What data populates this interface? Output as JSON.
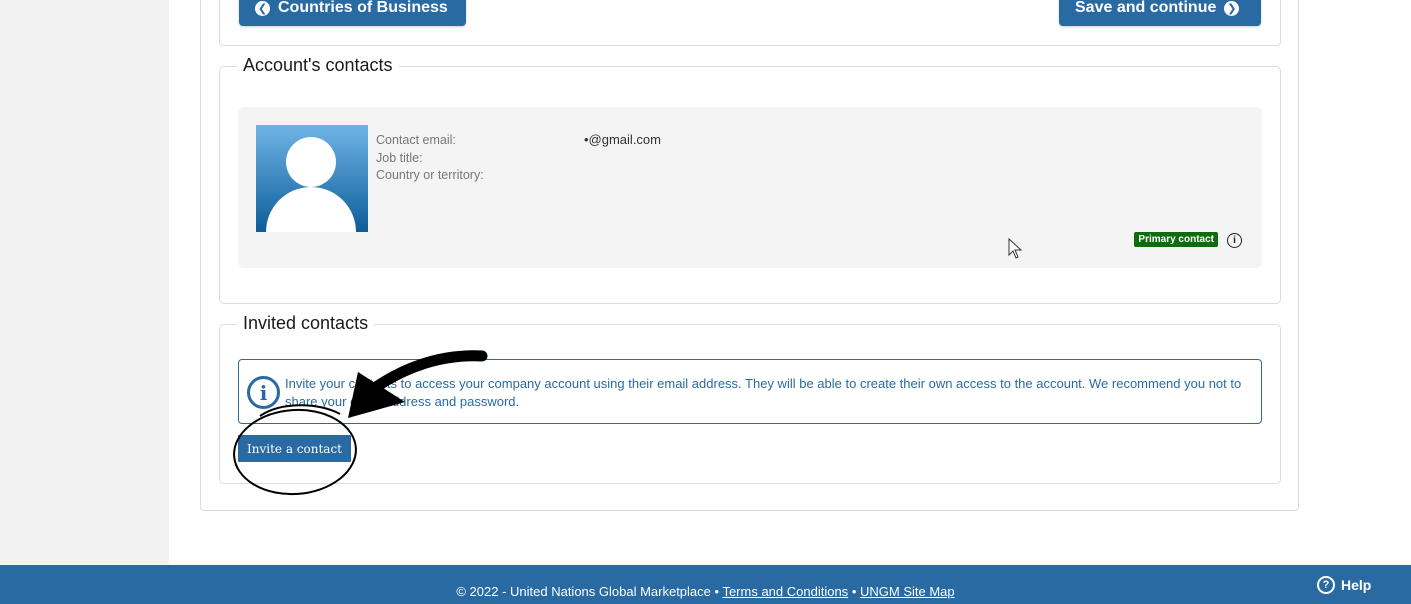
{
  "nav": {
    "back_label": "Countries of Business",
    "save_label": "Save and continue"
  },
  "accounts_contacts": {
    "legend": "Account's contacts",
    "contact_email_label": "Contact email:",
    "job_title_label": "Job title:",
    "country_label": "Country or territory:",
    "contact_email_value": "•@gmail.com",
    "primary_badge": "Primary contact"
  },
  "invited_contacts": {
    "legend": "Invited contacts",
    "info_message": "Invite your contacts to access your company account using their email address. They will be able to create their own access to the account. We recommend you not to share your email address and password.",
    "invite_button": "Invite a contact"
  },
  "footer": {
    "copyright": "© 2022 - United Nations Global Marketplace •",
    "terms": "Terms and Conditions",
    "separator": "•",
    "site_map": "UNGM Site Map",
    "help": "Help"
  },
  "colors": {
    "brand": "#2a6aa3",
    "badge": "#0e6b0e"
  },
  "icons": [
    "arrow-left-circle-icon",
    "arrow-right-circle-icon",
    "user-avatar-icon",
    "info-icon",
    "help-icon",
    "cursor-icon"
  ]
}
